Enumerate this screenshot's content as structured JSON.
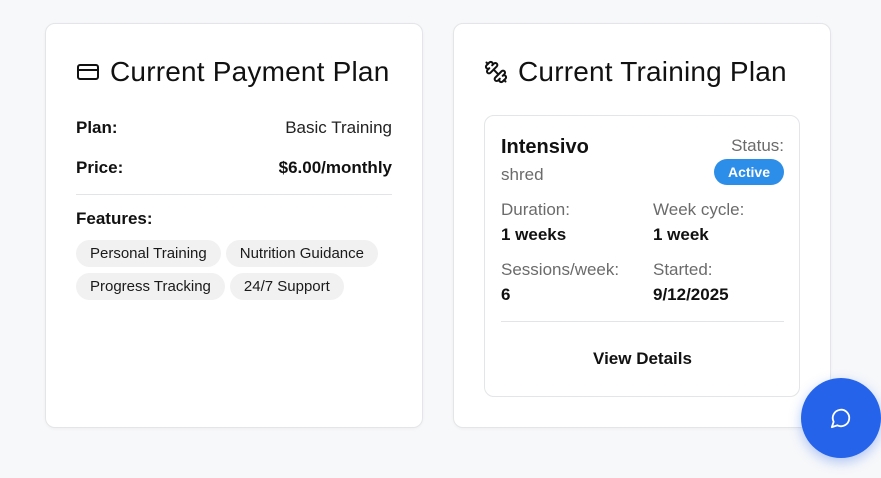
{
  "payment_card": {
    "title": "Current Payment Plan",
    "icon": "credit-card-icon",
    "plan_label": "Plan:",
    "plan_value": "Basic Training",
    "price_label": "Price:",
    "price_value": "$6.00/monthly",
    "features_label": "Features:",
    "features": [
      "Personal Training",
      "Nutrition Guidance",
      "Progress Tracking",
      "24/7 Support"
    ]
  },
  "training_card": {
    "title": "Current Training Plan",
    "icon": "dumbbell-icon",
    "plan_name": "Intensivo",
    "plan_subtitle": "shred",
    "status_label": "Status:",
    "status_value": "Active",
    "duration_label": "Duration:",
    "duration_value": "1 weeks",
    "week_cycle_label": "Week cycle:",
    "week_cycle_value": "1 week",
    "sessions_label": "Sessions/week:",
    "sessions_value": "6",
    "started_label": "Started:",
    "started_value": "9/12/2025",
    "view_details_label": "View Details"
  },
  "chat_fab": {
    "icon": "chat-bubble-icon"
  },
  "colors": {
    "accent": "#2563eb",
    "status_active": "#2c8ee8",
    "background": "#f7f8fa"
  }
}
